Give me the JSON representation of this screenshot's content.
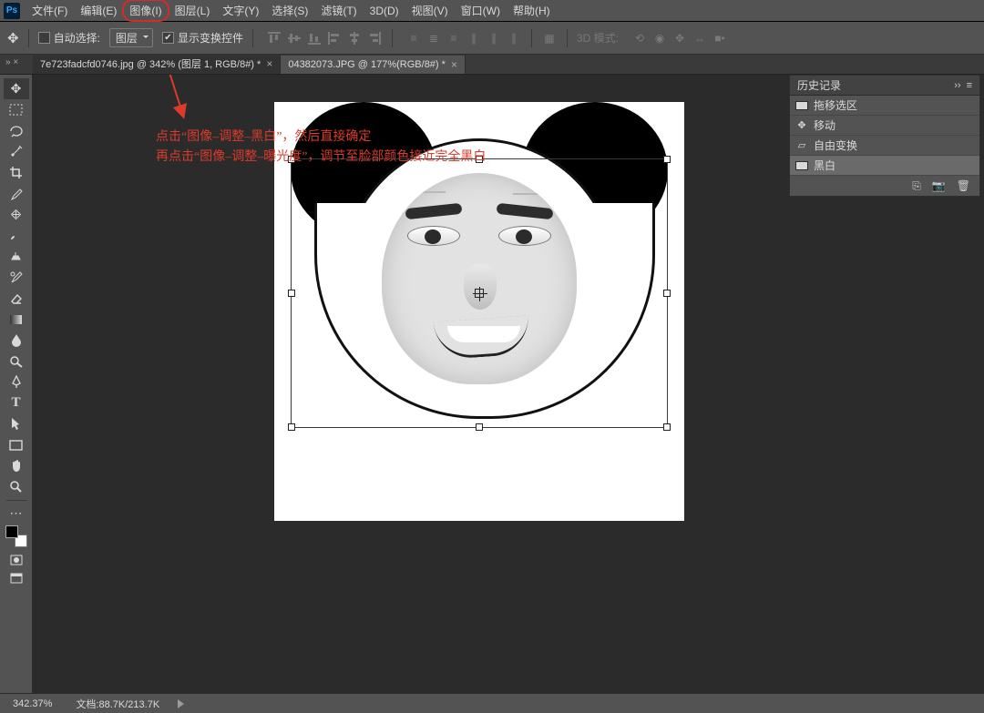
{
  "menu": {
    "items": [
      "文件(F)",
      "编辑(E)",
      "图像(I)",
      "图层(L)",
      "文字(Y)",
      "选择(S)",
      "滤镜(T)",
      "3D(D)",
      "视图(V)",
      "窗口(W)",
      "帮助(H)"
    ],
    "highlightIndex": 2,
    "logo": "Ps"
  },
  "options": {
    "autoSelectLabel": "自动选择:",
    "autoSelectChecked": false,
    "selectScope": "图层",
    "showTransformLabel": "显示变换控件",
    "showTransformChecked": true,
    "mode3d": "3D 模式:"
  },
  "tabs": [
    {
      "label": "7e723fadcfd0746.jpg @ 342% (图层 1, RGB/8#) *",
      "active": true
    },
    {
      "label": "04382073.JPG @ 177%(RGB/8#) *",
      "active": false
    }
  ],
  "tabsPrefix": "»  ×",
  "historyPanel": {
    "title": "历史记录",
    "rows": [
      {
        "label": "拖移选区",
        "icon": "thumb"
      },
      {
        "label": "移动",
        "icon": "move"
      },
      {
        "label": "自由变换",
        "icon": "transform"
      },
      {
        "label": "黑白",
        "icon": "bw"
      }
    ],
    "selectedIndex": 3
  },
  "annotation": {
    "line1": "点击“图像–调整–黑白”，然后直接确定",
    "line2": "再点击“图像–调整–曝光度”，调节至脸部颜色接近完全黑白",
    "arrowColor": "#dc3b2c"
  },
  "status": {
    "zoom": "342.37%",
    "docInfo": "文档:88.7K/213.7K"
  },
  "icons": {
    "close": "×",
    "collapse": "››",
    "menu": "≡",
    "newSnap": "⎘",
    "camera": "📷",
    "trash": "🗑"
  }
}
